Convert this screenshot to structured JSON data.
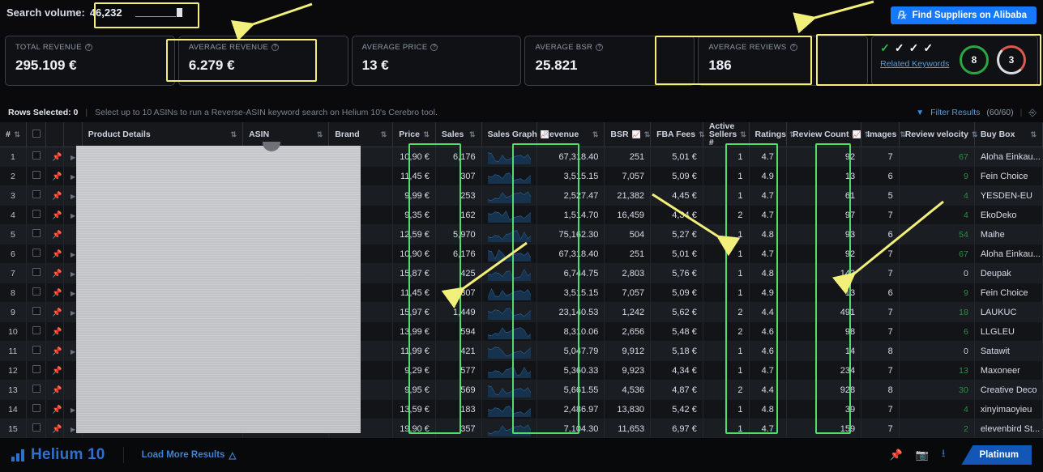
{
  "topbar": {
    "search_volume_label": "Search volume:",
    "search_volume_value": "46,232",
    "alibaba_button": "Find Suppliers on Alibaba"
  },
  "cards": [
    {
      "label": "TOTAL REVENUE",
      "value": "295.109 €"
    },
    {
      "label": "AVERAGE REVENUE",
      "value": "6.279 €"
    },
    {
      "label": "AVERAGE PRICE",
      "value": "13 €"
    },
    {
      "label": "AVERAGE BSR",
      "value": "25.821"
    },
    {
      "label": "AVERAGE REVIEWS",
      "value": "186"
    }
  ],
  "keyword_card": {
    "related_keywords_link": "Related Keywords",
    "checks": [
      "green",
      "white",
      "white",
      "white"
    ],
    "ring_green_value": "8",
    "ring_red_value": "3"
  },
  "selection_bar": {
    "rows_selected_label": "Rows Selected: 0",
    "divider": "|",
    "hint": "Select up to 10 ASINs to run a Reverse-ASIN keyword search on Helium 10's Cerebro tool.",
    "filter_label": "Filter Results",
    "filter_count": "(60/60)"
  },
  "table": {
    "columns": [
      {
        "key": "idx",
        "label": "#",
        "sortable": true,
        "graph": false
      },
      {
        "key": "check",
        "label": "",
        "sortable": false,
        "graph": false
      },
      {
        "key": "pin",
        "label": "",
        "sortable": false,
        "graph": false
      },
      {
        "key": "details",
        "label": "Product Details",
        "sortable": true,
        "graph": false
      },
      {
        "key": "asin",
        "label": "ASIN",
        "sortable": true,
        "graph": false
      },
      {
        "key": "brand",
        "label": "Brand",
        "sortable": true,
        "graph": false
      },
      {
        "key": "price",
        "label": "Price",
        "sortable": true,
        "graph": false
      },
      {
        "key": "sales",
        "label": "Sales",
        "sortable": true,
        "graph": false
      },
      {
        "key": "graph",
        "label": "Sales Graph",
        "sortable": false,
        "graph": true
      },
      {
        "key": "revenue",
        "label": "Revenue",
        "sortable": true,
        "graph": false
      },
      {
        "key": "bsr",
        "label": "BSR",
        "sortable": true,
        "graph": true
      },
      {
        "key": "fba",
        "label": "FBA Fees",
        "sortable": true,
        "graph": false
      },
      {
        "key": "sellers",
        "label": "Active Sellers #",
        "sortable": true,
        "graph": false
      },
      {
        "key": "ratings",
        "label": "Ratings",
        "sortable": true,
        "graph": false
      },
      {
        "key": "reviews",
        "label": "Review Count",
        "sortable": true,
        "graph": true
      },
      {
        "key": "images",
        "label": "Images",
        "sortable": true,
        "graph": false
      },
      {
        "key": "velocity",
        "label": "Review velocity",
        "sortable": true,
        "graph": false
      },
      {
        "key": "buybox",
        "label": "Buy Box",
        "sortable": true,
        "graph": false
      }
    ],
    "rows": [
      {
        "idx": "1",
        "price": "10,90 €",
        "sales": "6,176",
        "revenue": "67,318.40",
        "bsr": "251",
        "fba": "5,01 €",
        "sellers": "1",
        "ratings": "4.7",
        "reviews": "92",
        "images": "7",
        "velocity": "67",
        "buybox": "Aloha Einkau..."
      },
      {
        "idx": "2",
        "price": "11,45 €",
        "sales": "307",
        "revenue": "3,515.15",
        "bsr": "7,057",
        "fba": "5,09 €",
        "sellers": "1",
        "ratings": "4.9",
        "reviews": "13",
        "images": "6",
        "velocity": "9",
        "buybox": "Fein Choice"
      },
      {
        "idx": "3",
        "price": "9,99 €",
        "sales": "253",
        "revenue": "2,527.47",
        "bsr": "21,382",
        "fba": "4,45 €",
        "sellers": "1",
        "ratings": "4.7",
        "reviews": "61",
        "images": "5",
        "velocity": "4",
        "buybox": "YESDEN-EU"
      },
      {
        "idx": "4",
        "price": "9,35 €",
        "sales": "162",
        "revenue": "1,514.70",
        "bsr": "16,459",
        "fba": "4,34 €",
        "sellers": "2",
        "ratings": "4.7",
        "reviews": "97",
        "images": "7",
        "velocity": "4",
        "buybox": "EkoDeko"
      },
      {
        "idx": "5",
        "price": "12,59 €",
        "sales": "5,970",
        "revenue": "75,162.30",
        "bsr": "504",
        "fba": "5,27 €",
        "sellers": "1",
        "ratings": "4.8",
        "reviews": "93",
        "images": "6",
        "velocity": "54",
        "buybox": "Maihe"
      },
      {
        "idx": "6",
        "price": "10,90 €",
        "sales": "6,176",
        "revenue": "67,318.40",
        "bsr": "251",
        "fba": "5,01 €",
        "sellers": "1",
        "ratings": "4.7",
        "reviews": "92",
        "images": "7",
        "velocity": "67",
        "buybox": "Aloha Einkau..."
      },
      {
        "idx": "7",
        "price": "15,87 €",
        "sales": "425",
        "revenue": "6,744.75",
        "bsr": "2,803",
        "fba": "5,76 €",
        "sellers": "1",
        "ratings": "4.8",
        "reviews": "143",
        "images": "7",
        "velocity": "0",
        "buybox": "Deupak"
      },
      {
        "idx": "8",
        "price": "11,45 €",
        "sales": "307",
        "revenue": "3,515.15",
        "bsr": "7,057",
        "fba": "5,09 €",
        "sellers": "1",
        "ratings": "4.9",
        "reviews": "13",
        "images": "6",
        "velocity": "9",
        "buybox": "Fein Choice"
      },
      {
        "idx": "9",
        "price": "15,97 €",
        "sales": "1,449",
        "revenue": "23,140.53",
        "bsr": "1,242",
        "fba": "5,62 €",
        "sellers": "2",
        "ratings": "4.4",
        "reviews": "491",
        "images": "7",
        "velocity": "18",
        "buybox": "LAUKUC"
      },
      {
        "idx": "10",
        "price": "13,99 €",
        "sales": "594",
        "revenue": "8,310.06",
        "bsr": "2,656",
        "fba": "5,48 €",
        "sellers": "2",
        "ratings": "4.6",
        "reviews": "98",
        "images": "7",
        "velocity": "6",
        "buybox": "LLGLEU"
      },
      {
        "idx": "11",
        "price": "11,99 €",
        "sales": "421",
        "revenue": "5,047.79",
        "bsr": "9,912",
        "fba": "5,18 €",
        "sellers": "1",
        "ratings": "4.6",
        "reviews": "14",
        "images": "8",
        "velocity": "0",
        "buybox": "Satawit"
      },
      {
        "idx": "12",
        "price": "9,29 €",
        "sales": "577",
        "revenue": "5,360.33",
        "bsr": "9,923",
        "fba": "4,34 €",
        "sellers": "1",
        "ratings": "4.7",
        "reviews": "234",
        "images": "7",
        "velocity": "13",
        "buybox": "Maxoneer"
      },
      {
        "idx": "13",
        "price": "9,95 €",
        "sales": "569",
        "revenue": "5,661.55",
        "bsr": "4,536",
        "fba": "4,87 €",
        "sellers": "2",
        "ratings": "4.4",
        "reviews": "928",
        "images": "8",
        "velocity": "30",
        "buybox": "Creative Deco"
      },
      {
        "idx": "14",
        "price": "13,59 €",
        "sales": "183",
        "revenue": "2,486.97",
        "bsr": "13,830",
        "fba": "5,42 €",
        "sellers": "1",
        "ratings": "4.8",
        "reviews": "39",
        "images": "7",
        "velocity": "4",
        "buybox": "xinyimaoyieu"
      },
      {
        "idx": "15",
        "price": "19,90 €",
        "sales": "357",
        "revenue": "7,104.30",
        "bsr": "11,653",
        "fba": "6,97 €",
        "sellers": "1",
        "ratings": "4.7",
        "reviews": "159",
        "images": "7",
        "velocity": "2",
        "buybox": "elevenbird St..."
      }
    ]
  },
  "footer": {
    "brand": "Helium 10",
    "load_more": "Load More Results",
    "plan_badge": "Platinum"
  },
  "annotations": {
    "highlight_yellow": "#f2ef7a",
    "highlight_green": "#52dd6b",
    "accent_blue": "#1479ff"
  }
}
